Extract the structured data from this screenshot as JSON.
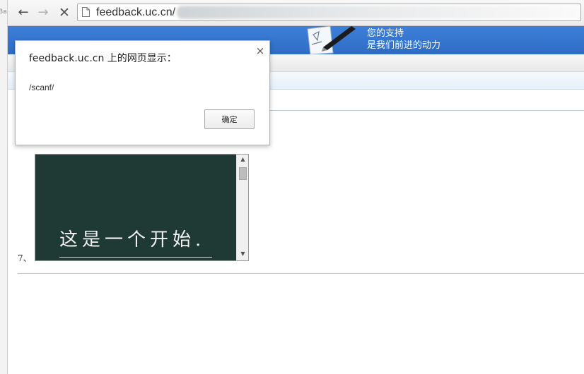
{
  "window": {
    "left_edge_text": "Ba"
  },
  "toolbar": {
    "back_icon": "arrow-left-icon",
    "forward_icon": "arrow-right-icon",
    "stop_icon": "close-icon",
    "url": "feedback.uc.cn/"
  },
  "banner": {
    "slogan_line1": "您的支持",
    "slogan_line2": "是我们前进的动力",
    "colors": {
      "banner": "#2f6cc4"
    }
  },
  "content": {
    "item_number": "7、",
    "slide_text": "这是一个开始.",
    "colors": {
      "slide_bg": "#1f3a35"
    }
  },
  "dialog": {
    "title": "feedback.uc.cn 上的网页显示：",
    "message": "/scanf/",
    "ok_label": "确定",
    "close_icon": "close-icon"
  }
}
